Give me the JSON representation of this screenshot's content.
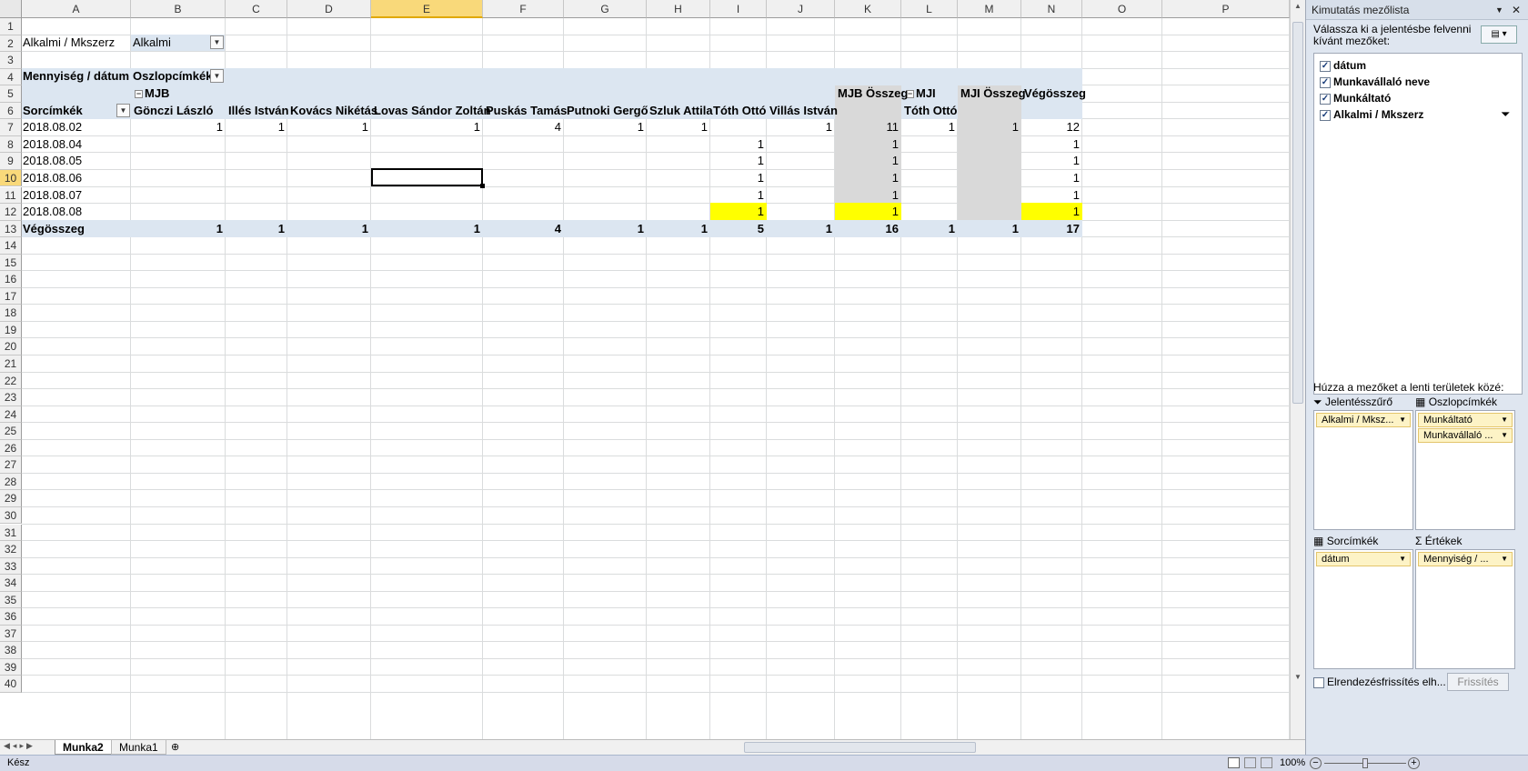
{
  "columns": [
    "A",
    "B",
    "C",
    "D",
    "E",
    "F",
    "G",
    "H",
    "I",
    "J",
    "K",
    "L",
    "M",
    "N",
    "O",
    "P"
  ],
  "rows": [
    "1",
    "2",
    "3",
    "4",
    "5",
    "6",
    "7",
    "8",
    "9",
    "10",
    "11",
    "12",
    "13",
    "14",
    "15",
    "16",
    "17",
    "18",
    "19",
    "20",
    "21",
    "22",
    "23",
    "24",
    "25",
    "26",
    "27",
    "28",
    "29",
    "30",
    "31",
    "32",
    "33",
    "34",
    "35",
    "36",
    "37",
    "38",
    "39",
    "40"
  ],
  "filter": {
    "label": "Alkalmi / Mkszerz",
    "value": "Alkalmi"
  },
  "pivot": {
    "value_label": "Mennyiség / dátum",
    "col_labels": "Oszlopcímkék",
    "row_labels": "Sorcímkék",
    "group1": "MJB",
    "group2": "MJI",
    "headers": [
      "Gönczi László",
      "Illés István",
      "Kovács Nikétás",
      "Lovas Sándor Zoltán",
      "Puskás Tamás",
      "Putnoki Gergő",
      "Szluk Attila",
      "Tóth Ottó",
      "Villás István",
      "MJB Összeg",
      "Tóth Ottó",
      "MJI Összeg",
      "Végösszeg"
    ],
    "rows": [
      {
        "label": "2018.08.02",
        "values": [
          "1",
          "1",
          "1",
          "1",
          "4",
          "1",
          "1",
          "",
          "1",
          "11",
          "1",
          "1",
          "12"
        ]
      },
      {
        "label": "2018.08.04",
        "values": [
          "",
          "",
          "",
          "",
          "",
          "",
          "",
          "1",
          "",
          "1",
          "",
          "",
          "1"
        ]
      },
      {
        "label": "2018.08.05",
        "values": [
          "",
          "",
          "",
          "",
          "",
          "",
          "",
          "1",
          "",
          "1",
          "",
          "",
          "1"
        ]
      },
      {
        "label": "2018.08.06",
        "values": [
          "",
          "",
          "",
          "",
          "",
          "",
          "",
          "1",
          "",
          "1",
          "",
          "",
          "1"
        ]
      },
      {
        "label": "2018.08.07",
        "values": [
          "",
          "",
          "",
          "",
          "",
          "",
          "",
          "1",
          "",
          "1",
          "",
          "",
          "1"
        ]
      },
      {
        "label": "2018.08.08",
        "values": [
          "",
          "",
          "",
          "",
          "",
          "",
          "",
          "1",
          "",
          "1",
          "",
          "",
          "1"
        ]
      }
    ],
    "total": {
      "label": "Végösszeg",
      "values": [
        "1",
        "1",
        "1",
        "1",
        "4",
        "1",
        "1",
        "5",
        "1",
        "16",
        "1",
        "1",
        "17"
      ]
    }
  },
  "tabs": [
    "Munka2",
    "Munka1"
  ],
  "status": {
    "ready": "Kész",
    "zoom": "100%"
  },
  "pane": {
    "title": "Kimutatás mezőlista",
    "instruction": "Válassza ki a jelentésbe felvenni kívánt mezőket:",
    "fields": [
      "dátum",
      "Munkavállaló neve",
      "Munkáltató",
      "Alkalmi / Mkszerz"
    ],
    "drag_hint": "Húzza a mezőket a lenti területek közé:",
    "areas": {
      "filter": {
        "label": "Jelentésszűrő",
        "chips": [
          "Alkalmi / Mksz..."
        ]
      },
      "columns": {
        "label": "Oszlopcímkék",
        "chips": [
          "Munkáltató",
          "Munkavállaló ..."
        ]
      },
      "rows": {
        "label": "Sorcímkék",
        "chips": [
          "dátum"
        ]
      },
      "values": {
        "label": "Értékek",
        "chips": [
          "Mennyiség / ..."
        ]
      }
    },
    "defer_label": "Elrendezésfrissítés elh...",
    "refresh_label": "Frissítés"
  }
}
